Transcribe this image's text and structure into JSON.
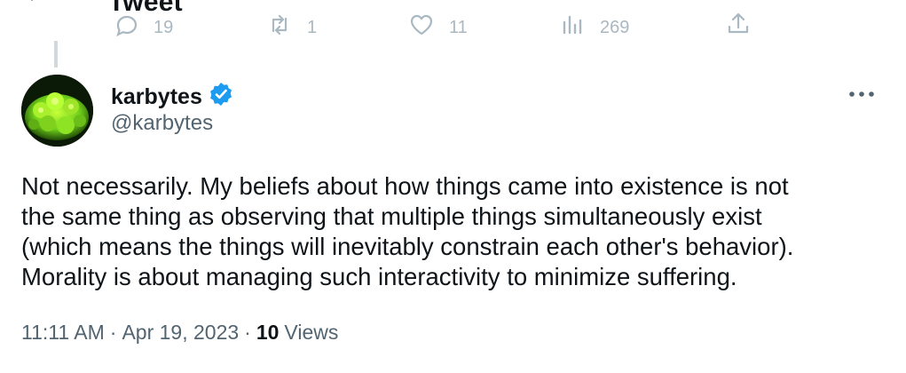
{
  "header": {
    "title": "Tweet",
    "back_icon": "back-arrow-icon"
  },
  "parent_actions": {
    "replies": "19",
    "retweets": "1",
    "likes": "11",
    "views": "269"
  },
  "tweet": {
    "display_name": "karbytes",
    "handle": "@karbytes",
    "verified": true,
    "text": "Not necessarily. My beliefs about how things came into existence is not\nthe same thing as observing that multiple things simultaneously exist\n(which means the things will inevitably constrain each other's behavior).\nMorality is about managing such interactivity to minimize suffering.",
    "time": "11:11 AM",
    "date": "Apr 19, 2023",
    "views_count": "10",
    "views_label": "Views",
    "separator": "·"
  },
  "colors": {
    "text_primary": "#0f1419",
    "text_secondary": "#536471",
    "verified_blue": "#1d9bf0",
    "action_gray": "#aab8c2"
  }
}
